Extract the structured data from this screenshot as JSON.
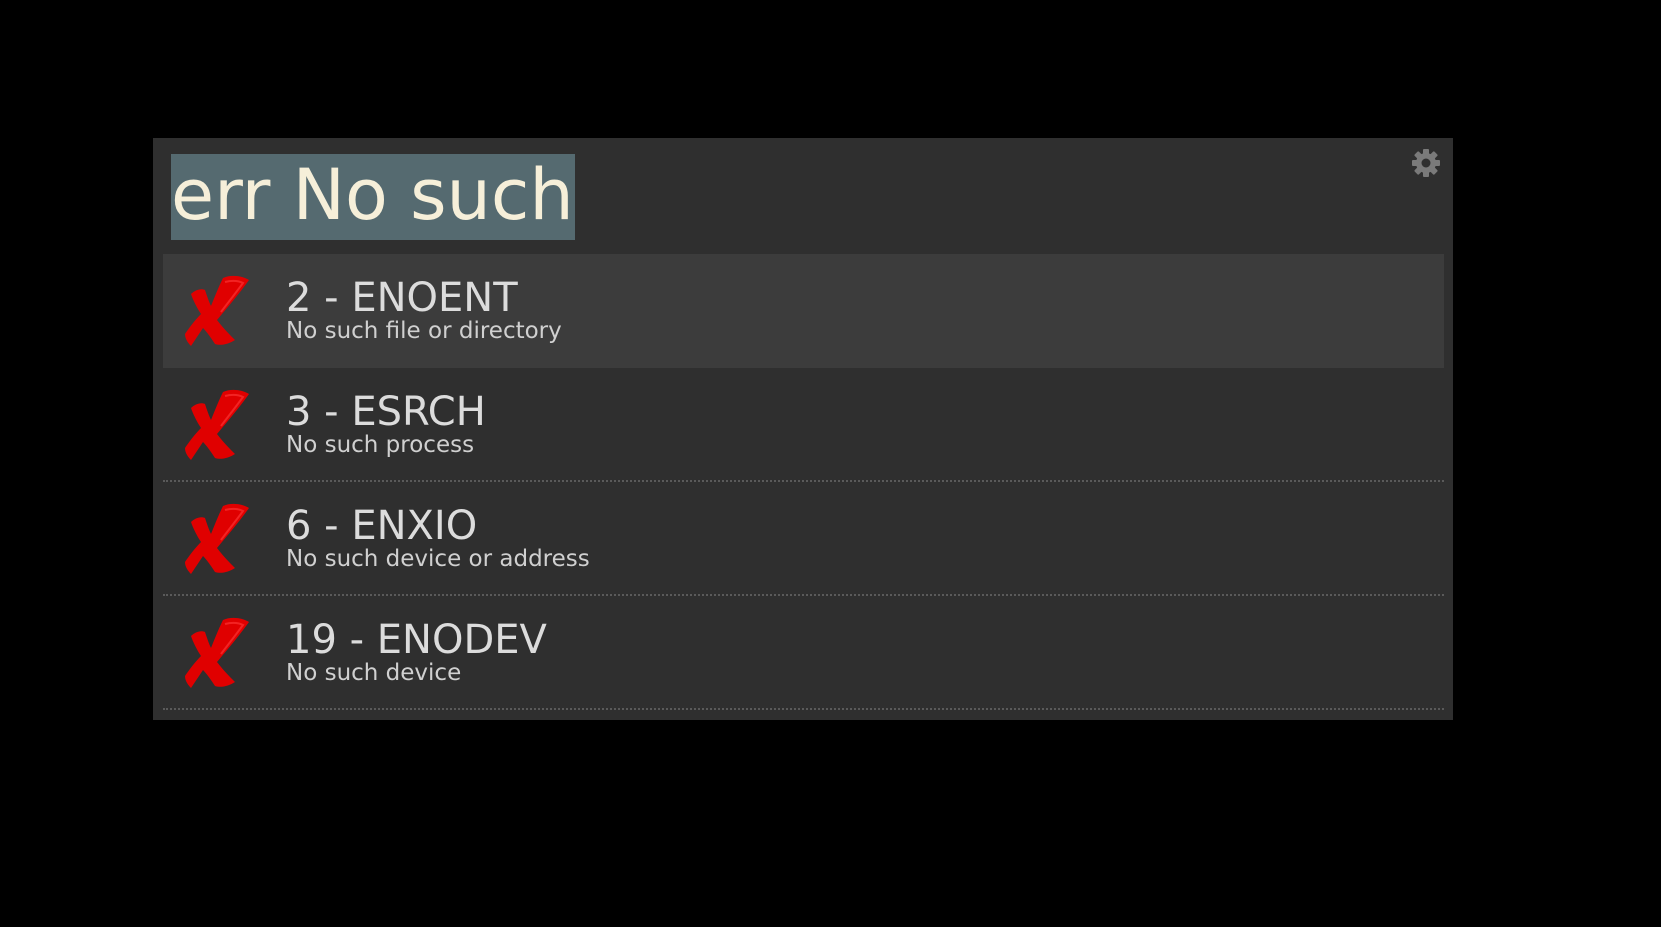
{
  "search": {
    "query": "err No such"
  },
  "settings": {
    "icon": "gear-icon"
  },
  "colors": {
    "window_background": "#2f2f2f",
    "selected_row": "#3c3c3c",
    "query_highlight": "#556a70",
    "query_text": "#f6efd9",
    "error_icon": "#e00000"
  },
  "results": [
    {
      "title": "2 - ENOENT",
      "description": "No such file or directory",
      "icon": "error-x-icon",
      "selected": true
    },
    {
      "title": "3 - ESRCH",
      "description": "No such process",
      "icon": "error-x-icon",
      "selected": false
    },
    {
      "title": "6 - ENXIO",
      "description": "No such device or address",
      "icon": "error-x-icon",
      "selected": false
    },
    {
      "title": "19 - ENODEV",
      "description": "No such device",
      "icon": "error-x-icon",
      "selected": false
    }
  ]
}
